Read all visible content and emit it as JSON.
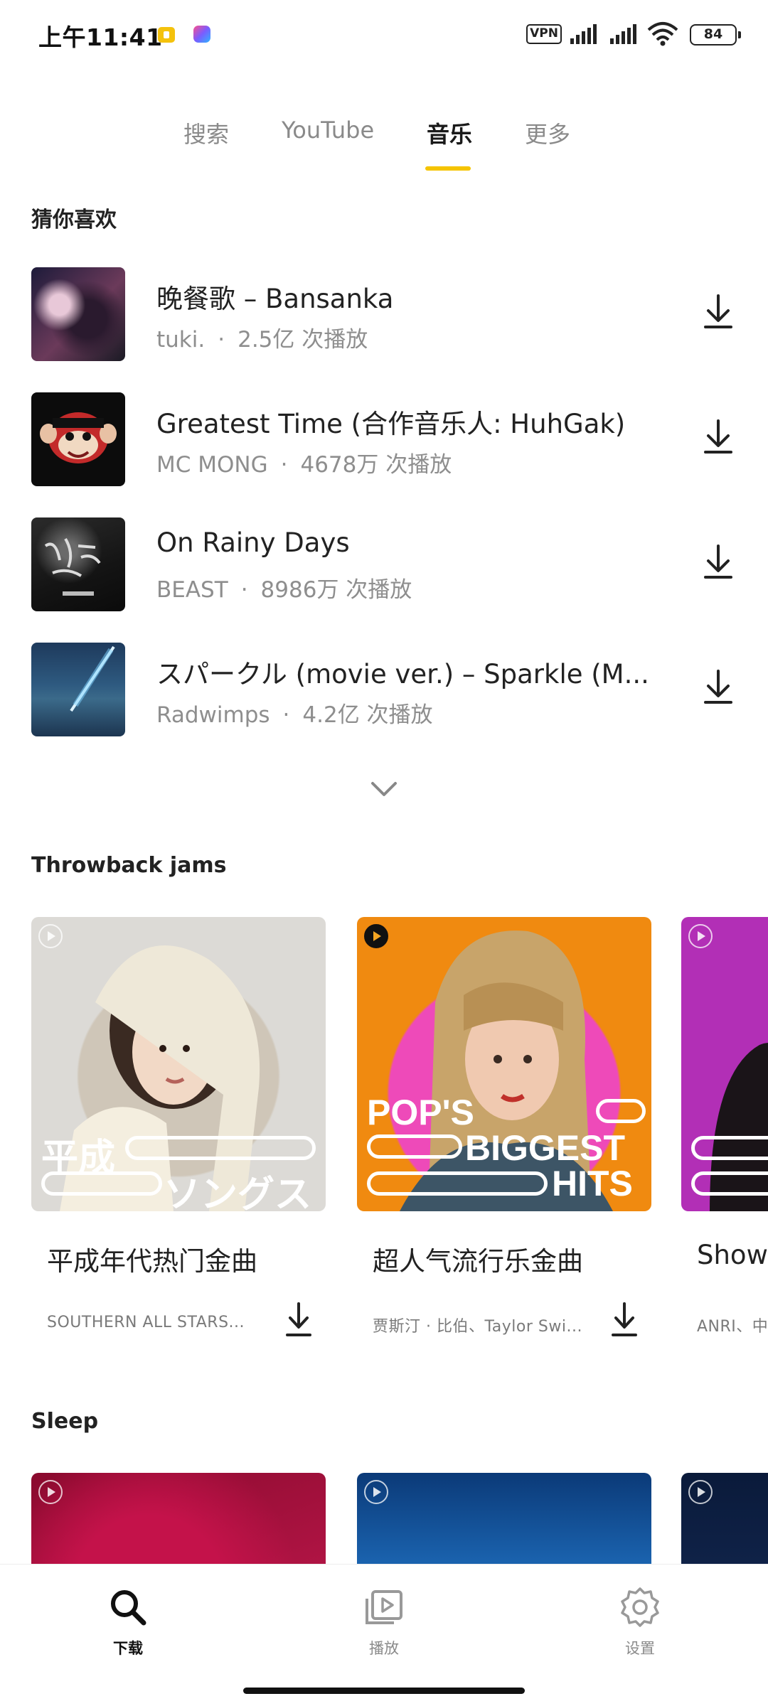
{
  "status_bar": {
    "time": "上午11:41",
    "vpn": "VPN",
    "battery": "84"
  },
  "tabs": [
    {
      "label": "搜索",
      "active": false
    },
    {
      "label": "YouTube",
      "active": false
    },
    {
      "label": "音乐",
      "active": true
    },
    {
      "label": "更多",
      "active": false
    }
  ],
  "recommend": {
    "title": "猜你喜欢",
    "songs": [
      {
        "title": "晚餐歌 – Bansanka",
        "artist": "tuki.",
        "plays": "2.5亿 次播放"
      },
      {
        "title": "Greatest Time (合作音乐人: HuhGak)",
        "artist": "MC MONG",
        "plays": "4678万 次播放"
      },
      {
        "title": "On Rainy Days",
        "artist": "BEAST",
        "plays": "8986万 次播放"
      },
      {
        "title": "スパークル (movie ver.) – Sparkle (M...",
        "artist": "Radwimps",
        "plays": "4.2亿 次播放"
      }
    ],
    "separator": "·"
  },
  "throwback": {
    "title": "Throwback jams",
    "cards": [
      {
        "title": "平成年代热门金曲",
        "subtitle": "SOUTHERN ALL STARS...",
        "cover_text_1": "平成",
        "cover_text_2": "ソングス"
      },
      {
        "title": "超人气流行乐金曲",
        "subtitle": "贾斯汀 · 比伯、Taylor Swi...",
        "cover_text_1": "POP'S",
        "cover_text_2": "BIGGEST",
        "cover_text_3": "HITS"
      },
      {
        "title": "Show",
        "subtitle": "ANRI、中森"
      }
    ]
  },
  "sleep": {
    "title": "Sleep"
  },
  "bottom_nav": [
    {
      "label": "下载",
      "icon": "search-icon",
      "active": true
    },
    {
      "label": "播放",
      "icon": "play-library-icon",
      "active": false
    },
    {
      "label": "设置",
      "icon": "gear-icon",
      "active": false
    }
  ],
  "colors": {
    "accent": "#f5c400",
    "text_primary": "#222222",
    "text_secondary": "#8e8e8e"
  }
}
